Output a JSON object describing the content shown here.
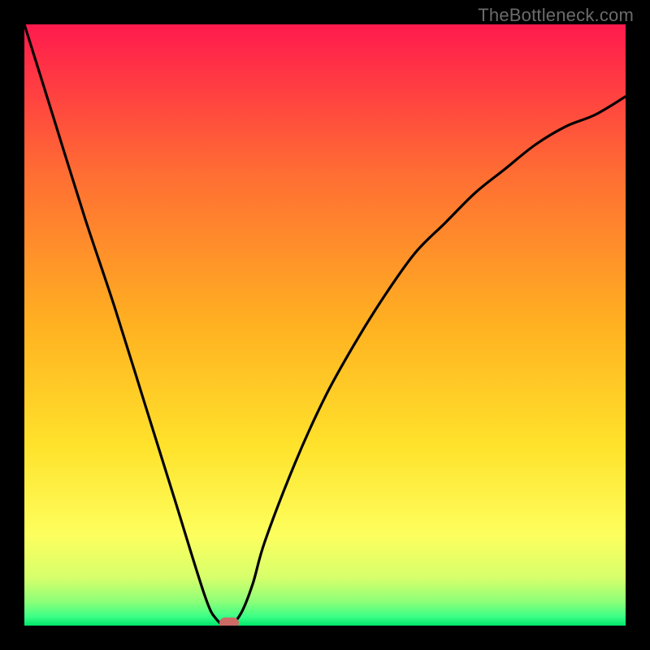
{
  "watermark": "TheBottleneck.com",
  "chart_data": {
    "type": "line",
    "title": "",
    "xlabel": "",
    "ylabel": "",
    "xlim": [
      0,
      100
    ],
    "ylim": [
      0,
      100
    ],
    "grid": false,
    "legend": null,
    "series": [
      {
        "name": "bottleneck-curve",
        "x": [
          0,
          5,
          10,
          15,
          20,
          25,
          30,
          32,
          34,
          36,
          38,
          40,
          45,
          50,
          55,
          60,
          65,
          70,
          75,
          80,
          85,
          90,
          95,
          100
        ],
        "values": [
          100,
          84,
          68,
          53,
          37,
          21,
          5,
          1,
          0,
          2,
          7,
          14,
          27,
          38,
          47,
          55,
          62,
          67,
          72,
          76,
          80,
          83,
          85,
          88
        ]
      }
    ],
    "min_point": {
      "x": 34,
      "y": 0
    },
    "marker": {
      "x": 34,
      "y": 0.4,
      "color": "#cc6b66"
    },
    "gradient_stops": [
      {
        "offset": 0.0,
        "color": "#ff1a4d"
      },
      {
        "offset": 0.25,
        "color": "#ff6e33"
      },
      {
        "offset": 0.5,
        "color": "#ffb121"
      },
      {
        "offset": 0.7,
        "color": "#ffe22b"
      },
      {
        "offset": 0.85,
        "color": "#fdff5e"
      },
      {
        "offset": 0.92,
        "color": "#d7ff6b"
      },
      {
        "offset": 0.96,
        "color": "#8dff78"
      },
      {
        "offset": 0.985,
        "color": "#3cff86"
      },
      {
        "offset": 1.0,
        "color": "#00e56b"
      }
    ]
  }
}
